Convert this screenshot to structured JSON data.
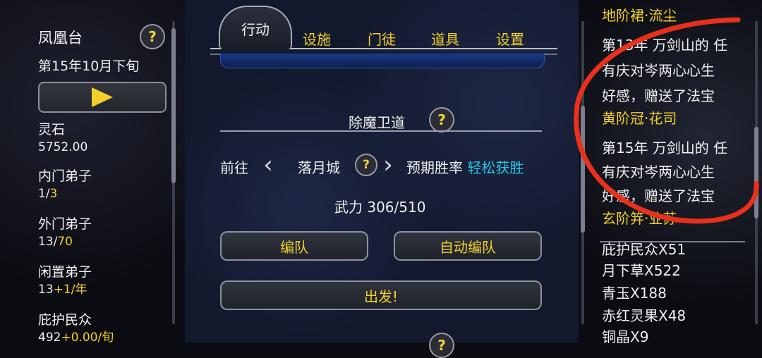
{
  "left": {
    "location": "凤凰台",
    "date": "第15年10月下旬",
    "help": "?",
    "stats": [
      {
        "label": "灵石",
        "value": "5752.00",
        "extra": ""
      },
      {
        "label": "内门弟子",
        "value": "1/",
        "extra": "3"
      },
      {
        "label": "外门弟子",
        "value": "13/",
        "extra": "70"
      },
      {
        "label": "闲置弟子",
        "value": "13",
        "extra": "+1/年"
      },
      {
        "label": "庇护民众",
        "value": "492",
        "extra": "+0.00/旬"
      }
    ]
  },
  "center": {
    "tabs": {
      "active": "行动",
      "others": [
        "设施",
        "门徒",
        "道具",
        "设置"
      ]
    },
    "section_title": "除魔卫道",
    "goto_label": "前往",
    "destination": "落月城",
    "win_rate_label": "预期胜率",
    "win_rate_value": "轻松获胜",
    "power": "武力 306/510",
    "buttons": {
      "formation": "编队",
      "auto_formation": "自动编队",
      "depart": "出发!"
    },
    "help": "?"
  },
  "right": {
    "log": [
      {
        "text": "地阶裙·流尘",
        "color": "#f2d028"
      },
      {
        "text": "第13年 万剑山的 任",
        "color": "#f0f0f0"
      },
      {
        "text": "有庆对岑两心心生",
        "color": "#f0f0f0"
      },
      {
        "text": "好感，赠送了法宝",
        "color": "#f0f0f0"
      },
      {
        "text": "黄阶冠·花司",
        "color": "#f2d028"
      },
      {
        "text": "第15年 万剑山的 任",
        "color": "#f0f0f0"
      },
      {
        "text": "有庆对岑两心心生",
        "color": "#f0f0f0"
      },
      {
        "text": "好感，赠送了法宝",
        "color": "#f0f0f0"
      },
      {
        "text": "玄阶笄·业苏",
        "color": "#f2d028"
      }
    ],
    "items": [
      "庇护民众X51",
      "月下草X522",
      "青玉X188",
      "赤红灵果X48",
      "铜晶X9"
    ]
  },
  "colors": {
    "accent": "#f2d028",
    "cyan": "#27c6e8",
    "annotation": "#e8301c"
  }
}
